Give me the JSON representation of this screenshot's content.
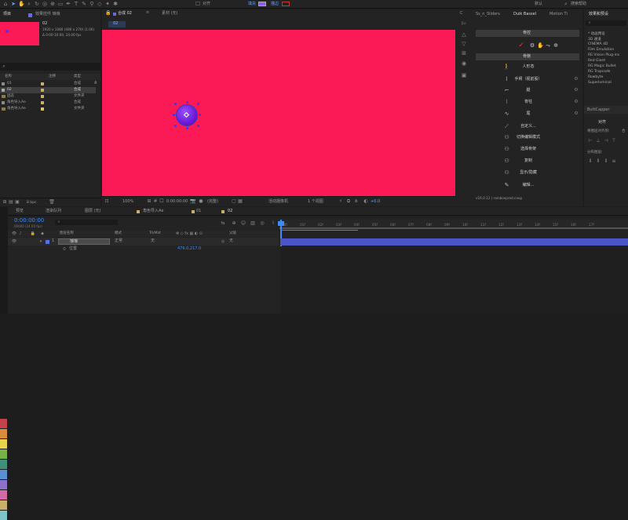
{
  "top_toolbar": {
    "snap_label": "对齐",
    "fill_label": "填充",
    "stroke_label": "描边",
    "default_label": "默认",
    "search_placeholder": "搜索帮助",
    "brand_color": "#8b5cf6"
  },
  "project_panel": {
    "tab_label": "项目",
    "effects_tab_label": "效果控件 琅琅",
    "comp_name": "02",
    "comp_info_1": "1920 x 1080 (480 x 270) (1.00)",
    "comp_info_2": "Δ 0:00:10:00, 24.00 fps",
    "search_placeholder": "",
    "columns": [
      "名称",
      "注释",
      "类型"
    ],
    "rows": [
      {
        "name": "01",
        "type": "合成",
        "color": "#c9b06a",
        "selected": false
      },
      {
        "name": "02",
        "type": "合成",
        "color": "#c9b06a",
        "selected": true
      },
      {
        "name": "固态",
        "type": "文件夹",
        "color": "#c9b06a",
        "selected": false
      },
      {
        "name": "角色导入Ae",
        "type": "合成",
        "color": "#c9b06a",
        "selected": false
      },
      {
        "name": "角色导入Ae",
        "type": "文件夹",
        "color": "#e0c35a",
        "selected": false
      }
    ],
    "bpc_label": "8 bpc"
  },
  "comp_viewer": {
    "tab_label": "合成 02",
    "footage_tab_label": "素材 (无)",
    "breadcrumb": "02",
    "background_color": "#fb1a55",
    "zoom": "100%",
    "timecode": "0:00:00:00",
    "quality": "(完整)",
    "camera": "活动摄像机",
    "views": "1 个视图",
    "exposure": "+0.0"
  },
  "duik_panel": {
    "tabs": [
      "Ss_n_Sliders",
      "Duik Bassel",
      "Motion Ti"
    ],
    "section_links": "骨控",
    "section_bones": "骨骼",
    "items": [
      {
        "icon": "person-icon",
        "label": "人形态"
      },
      {
        "icon": "arm-icon",
        "label": "手臂（视前股）"
      },
      {
        "icon": "leg-icon",
        "label": "腿"
      },
      {
        "icon": "spine-icon",
        "label": "脊柱"
      },
      {
        "icon": "tail-icon",
        "label": "尾"
      },
      {
        "icon": "custom-icon",
        "label": "自定义..."
      },
      {
        "icon": "toggle-icon",
        "label": "切换编辑模式"
      },
      {
        "icon": "select-icon",
        "label": "选择骨架"
      },
      {
        "icon": "duplicate-icon",
        "label": "复制"
      },
      {
        "icon": "visibility-icon",
        "label": "显示/隐藏"
      },
      {
        "icon": "edit-icon",
        "label": "编辑..."
      }
    ],
    "version": "v16.0.11 | rainboxprod.coop"
  },
  "effects_panel": {
    "tab_label": "效果和预设",
    "items": [
      "* 动画预设",
      "3D 通道",
      "CINEMA 4D",
      "Film Emulation",
      "RE:Vision Plug-ins",
      "Red Giant",
      "RG Magic Bullet",
      "RG Trapcode",
      "Rowbyte",
      "Superluminal"
    ],
    "buttcapper_label": "ButtCapper",
    "align_tab": "对齐",
    "align_to_label": "将图层对齐到:",
    "align_to_value": "合",
    "distribute_label": "分布图层:"
  },
  "timeline": {
    "tabs": [
      "预览",
      "渲染队列",
      "图层 (无)",
      "角色导入Ae",
      "01",
      "02"
    ],
    "timecode": "0:00:00:00",
    "frame_info": "00000 (24.00 fps)",
    "layer_columns": [
      "图层名称",
      "模式",
      "TrkMat",
      "父级"
    ],
    "layer": {
      "index": "1",
      "name": "琅琅",
      "mode": "正常",
      "trkmat": "无",
      "parent": "无"
    },
    "property": {
      "name": "位置",
      "value": "476.0,217.0"
    },
    "ruler_ticks": [
      "00f",
      "01f",
      "02f",
      "03f",
      "04f",
      "05f",
      "06f",
      "07f",
      "08f",
      "09f",
      "10f",
      "11f",
      "12f",
      "13f",
      "14f",
      "15f",
      "16f",
      "17f"
    ],
    "color_swatches": [
      "#c2434b",
      "#d88b3a",
      "#e8d24d",
      "#78b148",
      "#3f8f7a",
      "#5b8fd3",
      "#8b72c6",
      "#d16aa5",
      "#c9b06a",
      "#7ec4c9",
      "#c27c65",
      "#5f6f9a",
      "#9bb35c",
      "#b34a4a"
    ]
  }
}
